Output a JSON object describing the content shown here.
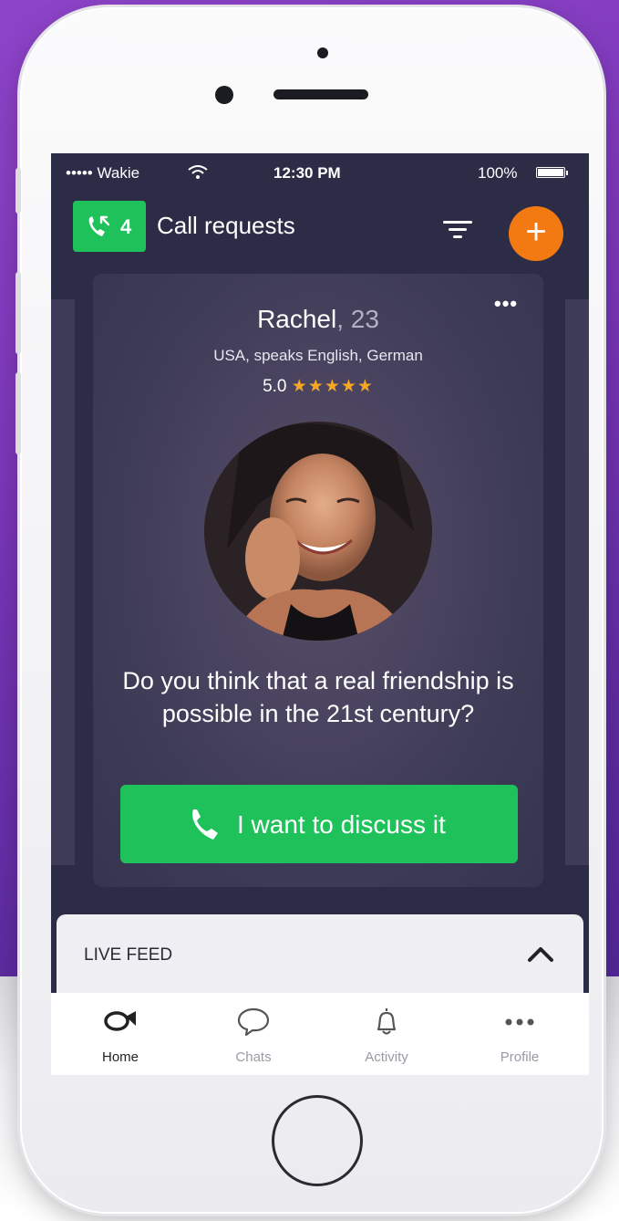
{
  "status_bar": {
    "carrier": "••••• Wakie",
    "time": "12:30 PM",
    "battery": "100%"
  },
  "header": {
    "call_count": "4",
    "title": "Call requests",
    "add_label": "+"
  },
  "card": {
    "menu_label": "•••",
    "name": "Rachel",
    "age": ", 23",
    "location": "USA, speaks English, German",
    "rating_value": "5.0",
    "stars": "★★★★★",
    "question": "Do you think that a real friendship is possible in the 21st century?",
    "cta_label": "I want to discuss it"
  },
  "live_feed": {
    "label": "LIVE FEED"
  },
  "tabs": [
    {
      "label": "Home",
      "icon": "horn-icon"
    },
    {
      "label": "Chats",
      "icon": "chat-bubble-icon"
    },
    {
      "label": "Activity",
      "icon": "bell-icon"
    },
    {
      "label": "Profile",
      "icon": "more-dots-icon"
    }
  ],
  "colors": {
    "background_purple": "#7a36b8",
    "screen_bg": "#2d2c47",
    "accent_green": "#1fc25a",
    "accent_orange": "#f37a12",
    "star_gold": "#f5a623"
  }
}
